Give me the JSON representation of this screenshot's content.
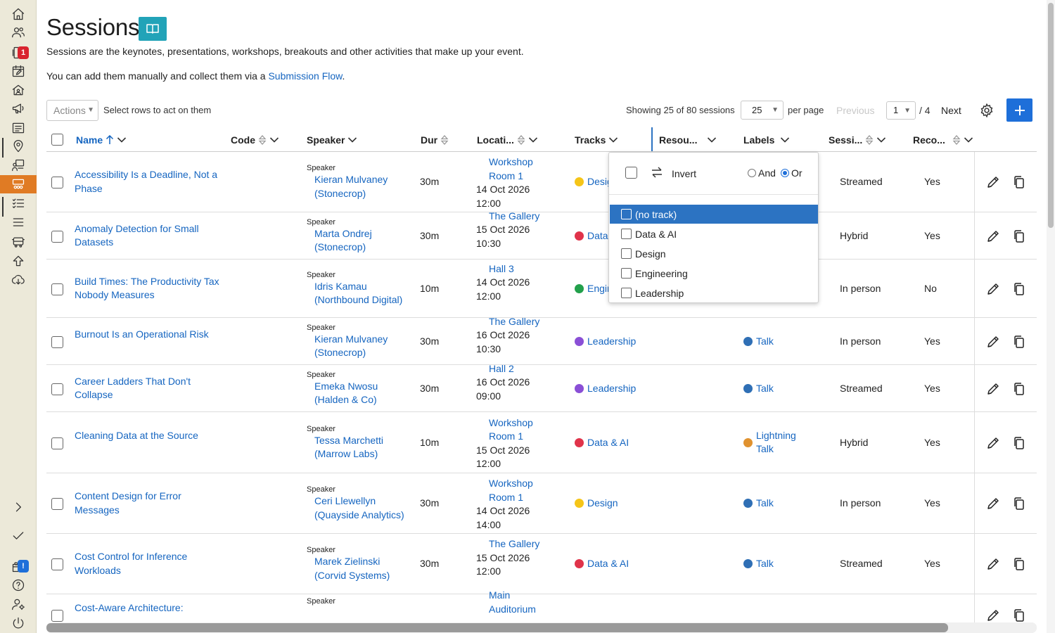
{
  "sidebar": {
    "items": [
      {
        "icon": "home-icon"
      },
      {
        "icon": "people-icon"
      },
      {
        "icon": "inbox-icon",
        "badge": "1"
      },
      {
        "icon": "calendar-edit-icon"
      },
      {
        "icon": "venue-icon"
      },
      {
        "icon": "megaphone-icon"
      },
      {
        "icon": "list-icon"
      },
      {
        "icon": "location-pin-icon"
      },
      {
        "icon": "presenter-icon"
      },
      {
        "icon": "sessions-icon",
        "active": true
      },
      {
        "icon": "checklist-icon"
      },
      {
        "icon": "menu-lines-icon"
      },
      {
        "icon": "bus-icon"
      },
      {
        "icon": "upload-icon"
      },
      {
        "icon": "cloud-download-icon"
      }
    ],
    "bottom": [
      {
        "icon": "chevron-right-icon"
      },
      {
        "icon": "checkmark-icon"
      },
      {
        "icon": "gift-icon",
        "badge": "!"
      },
      {
        "icon": "help-icon"
      },
      {
        "icon": "user-settings-icon"
      },
      {
        "icon": "power-icon"
      }
    ],
    "badge_color": "#d9232e",
    "info_badge_color": "#1e6fd9",
    "active_color": "#e07b24"
  },
  "page": {
    "title": "Sessions",
    "help_icon": "book-icon",
    "intro1": "Sessions are the keynotes, presentations, workshops, breakouts and other activities that make up your event.",
    "intro2_prefix": "You can add them manually and collect them via a ",
    "intro2_link": "Submission Flow",
    "intro2_suffix": "."
  },
  "toolbar": {
    "actions_label": "Actions",
    "select_hint": "Select rows to act on them",
    "showing": "Showing 25 of 80 sessions",
    "per_page_value": "25",
    "per_page_label": "per page",
    "previous": "Previous",
    "page_value": "1",
    "page_of": "/ 4",
    "next": "Next"
  },
  "columns": {
    "name": "Name",
    "code": "Code",
    "speaker": "Speaker",
    "duration": "Dur",
    "location": "Locati...",
    "tracks": "Tracks",
    "resources": "Resou...",
    "labels": "Labels",
    "session_type": "Sessi...",
    "recorded": "Reco..."
  },
  "track_colors": {
    "Design": "#f5c518",
    "Data & AI": "#e0334a",
    "Engineering": "#22a04b",
    "Leadership": "#8a4fd6"
  },
  "label_colors": {
    "Talk": "#2f6fb5",
    "Lightning Talk": "#e0922f"
  },
  "rows": [
    {
      "name": "Accessibility Is a Deadline, Not a Phase",
      "speaker_label": "Speaker",
      "speaker": "Kieran Mulvaney (Stonecrop)",
      "duration": "30m",
      "location": "Workshop Room 1",
      "datetime": "14 Oct 2026 12:00",
      "track": "Design",
      "track_color": "#f5c518",
      "label": "",
      "label_color": "",
      "session_type": "Streamed",
      "recorded": "Yes"
    },
    {
      "name": "Anomaly Detection for Small Datasets",
      "speaker_label": "Speaker",
      "speaker": "Marta Ondrej (Stonecrop)",
      "duration": "30m",
      "location": "The Gallery",
      "datetime": "15 Oct 2026 10:30",
      "track": "Data & AI",
      "track_color": "#e0334a",
      "label": "",
      "label_color": "",
      "session_type": "Hybrid",
      "recorded": "Yes"
    },
    {
      "name": "Build Times: The Productivity Tax Nobody Measures",
      "speaker_label": "Speaker",
      "speaker": "Idris Kamau (Northbound Digital)",
      "duration": "10m",
      "location": "Hall 3",
      "datetime": "14 Oct 2026 12:00",
      "track": "Engineering",
      "track_color": "#22a04b",
      "label": "",
      "label_color": "",
      "session_type": "In person",
      "recorded": "No"
    },
    {
      "name": "Burnout Is an Operational Risk",
      "speaker_label": "Speaker",
      "speaker": "Kieran Mulvaney (Stonecrop)",
      "duration": "30m",
      "location": "The Gallery",
      "datetime": "16 Oct 2026 10:30",
      "track": "Leadership",
      "track_color": "#8a4fd6",
      "label": "Talk",
      "label_color": "#2f6fb5",
      "session_type": "In person",
      "recorded": "Yes"
    },
    {
      "name": "Career Ladders That Don't Collapse",
      "speaker_label": "Speaker",
      "speaker": "Emeka Nwosu (Halden & Co)",
      "duration": "30m",
      "location": "Hall 2",
      "datetime": "16 Oct 2026 09:00",
      "track": "Leadership",
      "track_color": "#8a4fd6",
      "label": "Talk",
      "label_color": "#2f6fb5",
      "session_type": "Streamed",
      "recorded": "Yes"
    },
    {
      "name": "Cleaning Data at the Source",
      "speaker_label": "Speaker",
      "speaker": "Tessa Marchetti (Marrow Labs)",
      "duration": "10m",
      "location": "Workshop Room 1",
      "datetime": "15 Oct 2026 12:00",
      "track": "Data & AI",
      "track_color": "#e0334a",
      "label": "Lightning Talk",
      "label_color": "#e0922f",
      "session_type": "Hybrid",
      "recorded": "Yes"
    },
    {
      "name": "Content Design for Error Messages",
      "speaker_label": "Speaker",
      "speaker": "Ceri Llewellyn (Quayside Analytics)",
      "duration": "30m",
      "location": "Workshop Room 1",
      "datetime": "14 Oct 2026 14:00",
      "track": "Design",
      "track_color": "#f5c518",
      "label": "Talk",
      "label_color": "#2f6fb5",
      "session_type": "In person",
      "recorded": "Yes"
    },
    {
      "name": "Cost Control for Inference Workloads",
      "speaker_label": "Speaker",
      "speaker": "Marek Zielinski (Corvid Systems)",
      "duration": "30m",
      "location": "The Gallery",
      "datetime": "15 Oct 2026 12:00",
      "track": "Data & AI",
      "track_color": "#e0334a",
      "label": "Talk",
      "label_color": "#2f6fb5",
      "session_type": "Streamed",
      "recorded": "Yes"
    },
    {
      "name": "Cost-Aware Architecture:",
      "speaker_label": "Speaker",
      "speaker": "",
      "duration": "",
      "location": "Main Auditorium",
      "datetime": "",
      "track": "",
      "track_color": "",
      "label": "",
      "label_color": "",
      "session_type": "",
      "recorded": ""
    }
  ],
  "track_filter": {
    "invert_label": "Invert",
    "and_label": "And",
    "or_label": "Or",
    "mode": "Or",
    "options": [
      "(no track)",
      "Data & AI",
      "Design",
      "Engineering",
      "Leadership"
    ],
    "highlighted": "(no track)"
  }
}
